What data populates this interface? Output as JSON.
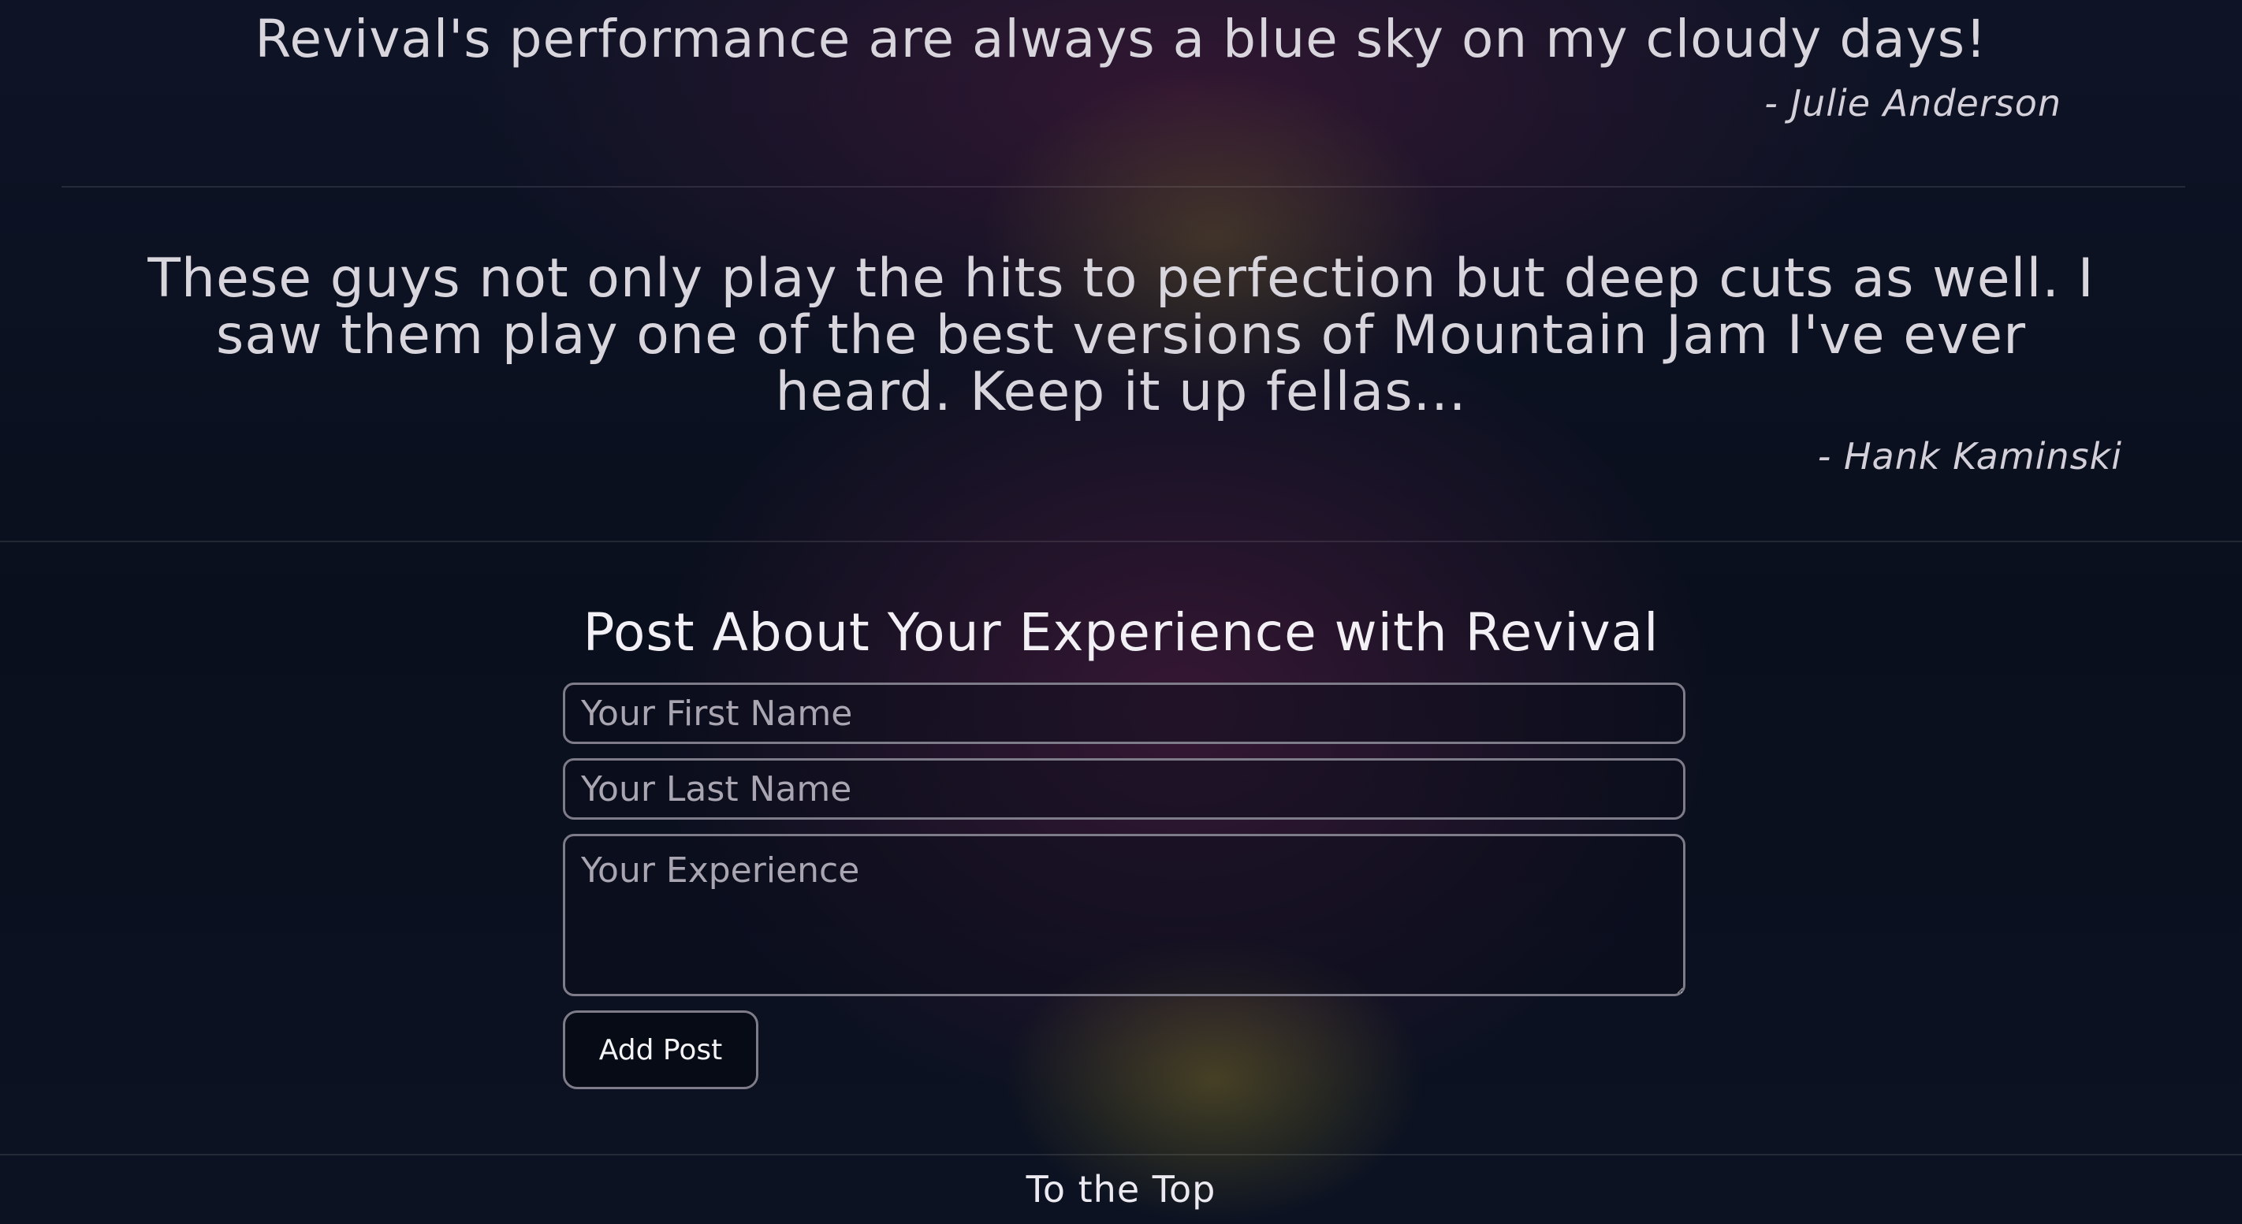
{
  "testimonials": [
    {
      "quote": "Revival's performance are always a blue sky on my cloudy days!",
      "author": "- Julie Anderson"
    },
    {
      "quote": "These guys not only play the hits to perfection but deep cuts as well. I saw them play one of the best versions of Mountain Jam I've ever heard. Keep it up fellas...",
      "author": "- Hank Kaminski"
    }
  ],
  "post_form": {
    "title": "Post About Your Experience with Revival",
    "first_name_placeholder": "Your First Name",
    "first_name_value": "",
    "last_name_placeholder": "Your Last Name",
    "last_name_value": "",
    "experience_placeholder": "Your Experience",
    "experience_value": "",
    "submit_label": "Add Post"
  },
  "footer": {
    "to_top_label": "To the Top"
  },
  "colors": {
    "background": "#0b1120",
    "text": "#d8d5dd",
    "field_border": "#7e7c89"
  }
}
